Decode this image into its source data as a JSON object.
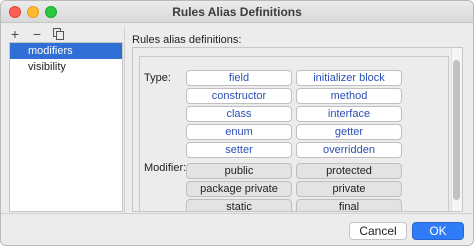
{
  "window": {
    "title": "Rules Alias Definitions"
  },
  "toolbar": {
    "add_label": "+",
    "remove_label": "−"
  },
  "list": {
    "items": [
      {
        "label": "modifiers"
      },
      {
        "label": "visibility"
      }
    ]
  },
  "right": {
    "heading": "Rules alias definitions:",
    "type_label": "Type:",
    "modifier_label": "Modifier:",
    "type_chips": [
      "field",
      "initializer block",
      "constructor",
      "method",
      "class",
      "interface",
      "enum",
      "getter",
      "setter",
      "overridden"
    ],
    "modifier_chips": [
      "public",
      "protected",
      "package private",
      "private",
      "static",
      "final"
    ]
  },
  "buttons": {
    "cancel": "Cancel",
    "ok": "OK"
  },
  "colors": {
    "accent": "#2f7cf6",
    "selection": "#2f6fd6",
    "type_text": "#2a4fb5"
  }
}
